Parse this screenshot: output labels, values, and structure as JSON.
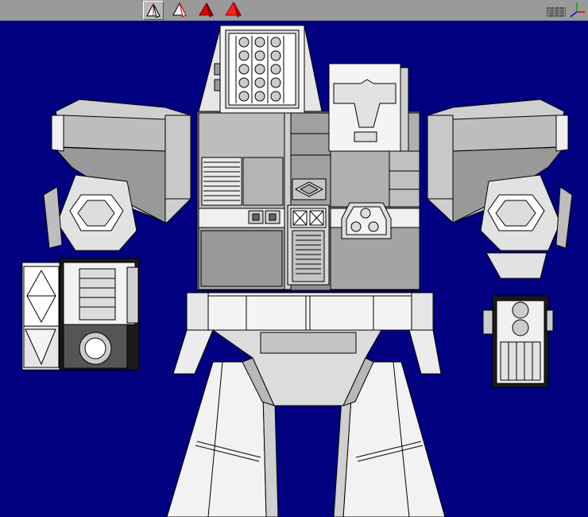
{
  "toolbar": {
    "mode_buttons": [
      {
        "icon": "wire-pyramid-icon",
        "state": "pressed"
      },
      {
        "icon": "flat-pyramid-icon",
        "state": "normal"
      },
      {
        "icon": "shaded-pyramid-icon",
        "state": "normal"
      },
      {
        "icon": "textured-pyramid-icon",
        "state": "normal"
      }
    ],
    "right_icons": [
      "grid-plane-icon",
      "axes-icon"
    ]
  },
  "viewport": {
    "background": "#000080",
    "subject": "mech-model-front-view"
  },
  "colors": {
    "model_light": "#f2f2f2",
    "model_mid": "#cfcfcf",
    "model_dark": "#8c8c8c",
    "outline": "#000000",
    "accent_red": "#e00000"
  }
}
